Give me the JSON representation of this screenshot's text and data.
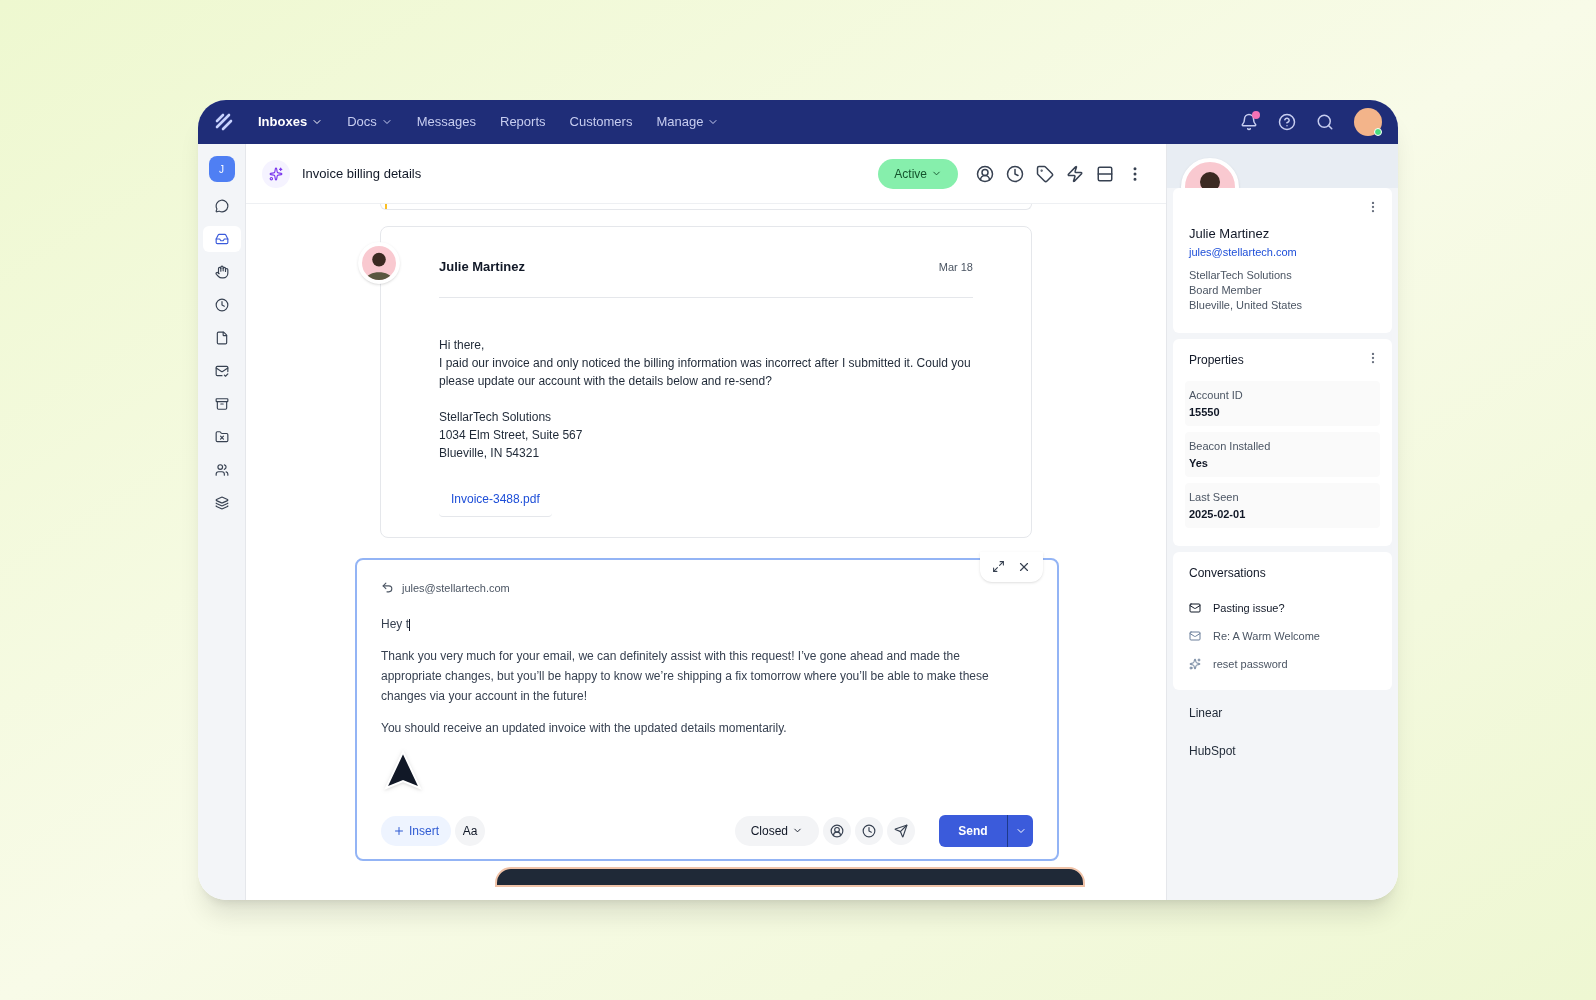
{
  "nav": {
    "items": [
      {
        "label": "Inboxes",
        "selected": true,
        "dropdown": true
      },
      {
        "label": "Docs",
        "selected": false,
        "dropdown": true
      },
      {
        "label": "Messages",
        "selected": false,
        "dropdown": false
      },
      {
        "label": "Reports",
        "selected": false,
        "dropdown": false
      },
      {
        "label": "Customers",
        "selected": false,
        "dropdown": false
      },
      {
        "label": "Manage",
        "selected": false,
        "dropdown": true
      }
    ],
    "notification": true
  },
  "sidebar": {
    "initial": "J",
    "items": [
      {
        "selected": false
      },
      {
        "selected": true
      },
      {
        "selected": false
      },
      {
        "selected": false
      },
      {
        "selected": false
      },
      {
        "selected": false
      },
      {
        "selected": false
      },
      {
        "selected": false
      },
      {
        "selected": false
      },
      {
        "selected": false
      }
    ]
  },
  "conversation": {
    "title": "Invoice billing details",
    "status": {
      "label": "Active",
      "color": "#86efac"
    }
  },
  "message": {
    "author": "Julie Martinez",
    "date": "Mar 18",
    "greeting": "Hi there,",
    "body": "I paid our invoice and only noticed the billing information was  incorrect after I submitted it. Could you please update our account with the details below and re-send?",
    "address": [
      "StellarTech Solutions",
      "1034 Elm Street, Suite 567",
      "Blueville, IN 54321"
    ],
    "attachment": "Invoice-3488.pdf"
  },
  "composer": {
    "to": "jules@stellartech.com",
    "greeting": "Hey t",
    "paragraphs": [
      "Thank you very much for your email, we can definitely assist with this request! I’ve gone ahead and made the appropriate changes, but you’ll be happy to know we’re shipping a fix tomorrow where you’ll be able to make these changes via your account in the future!",
      "You should receive an updated invoice with the updated details momentarily."
    ],
    "insert": "Insert",
    "format": "Aa",
    "status": "Closed",
    "send": "Send"
  },
  "contact": {
    "name": "Julie Martinez",
    "email": "jules@stellartech.com",
    "details": [
      "StellarTech Solutions",
      "Board Member",
      "Blueville, United States"
    ]
  },
  "properties": {
    "title": "Properties",
    "items": [
      {
        "label": "Account ID",
        "value": "15550"
      },
      {
        "label": "Beacon Installed",
        "value": "Yes"
      },
      {
        "label": "Last Seen",
        "value": "2025-02-01"
      }
    ]
  },
  "conversations": {
    "title": "Conversations",
    "items": [
      {
        "kind": "email",
        "label": "Pasting issue?",
        "selected": true
      },
      {
        "kind": "email",
        "label": "Re: A Warm Welcome",
        "selected": false
      },
      {
        "kind": "ai",
        "label": "reset password",
        "selected": false
      }
    ]
  },
  "apps": [
    "Linear",
    "HubSpot"
  ]
}
